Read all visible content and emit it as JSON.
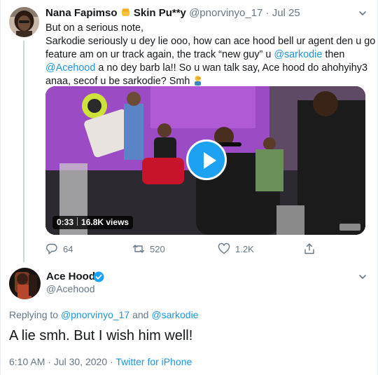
{
  "parent_tweet": {
    "display_name": "Nana Fapimso",
    "name_suffix": "Skin Pu**y",
    "handle": "@pnorvinyo_17",
    "separator": "·",
    "date": "Jul 25",
    "text": {
      "line1": "But on a serious note,",
      "line2": "Sarkodie seriously u dey lie ooo, how can ace hood bell ur agent den u go",
      "line3_a": "feature am on ur track again, the track “new guy” u ",
      "line3_mention": "@sarkodie",
      "line3_b": " then",
      "line4_mention": "@Acehood",
      "line4_b": " a no dey barb la!! So u wan talk say, Ace hood do ahohyihy3",
      "line5": "anaa, secof u be sarkodie? Smh"
    },
    "video": {
      "duration": "0:33",
      "views": "16.8K views"
    },
    "stats": {
      "replies": "64",
      "retweets": "520",
      "likes": "1.2K"
    }
  },
  "main_tweet": {
    "display_name": "Ace Hood",
    "handle": "@Acehood",
    "replying_prefix": "Replying to ",
    "replying_to_1": "@pnorvinyo_17",
    "replying_and": " and ",
    "replying_to_2": "@sarkodie",
    "text": "A lie smh. But I wish him well!",
    "time": "6:10 AM",
    "meta_sep1": " · ",
    "date": "Jul 30, 2020",
    "meta_sep2": " · ",
    "source": "Twitter for iPhone"
  },
  "colors": {
    "link": "#1b95e0",
    "muted": "#657786",
    "verified": "#1da1f2",
    "play_button": "#1da1f2",
    "thread_line": "#ccd6dd"
  },
  "icons": [
    "fist-emoji-icon",
    "chevron-down-icon",
    "person-facepalm-emoji-icon",
    "play-icon",
    "reply-icon",
    "retweet-icon",
    "like-icon",
    "share-icon",
    "verified-badge-icon"
  ]
}
